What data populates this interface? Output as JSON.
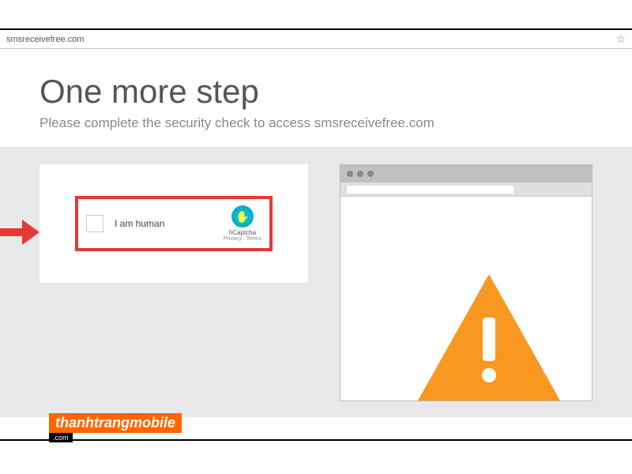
{
  "address_bar": {
    "url": "smsreceivefree.com"
  },
  "header": {
    "title": "One more step",
    "subtitle": "Please complete the security check to access smsreceivefree.com"
  },
  "captcha": {
    "label": "I am human",
    "brand": "hCaptcha",
    "links": "Privacy · Terms"
  },
  "watermark": {
    "main": "thanhtrangmobile",
    "sub": ".com"
  }
}
